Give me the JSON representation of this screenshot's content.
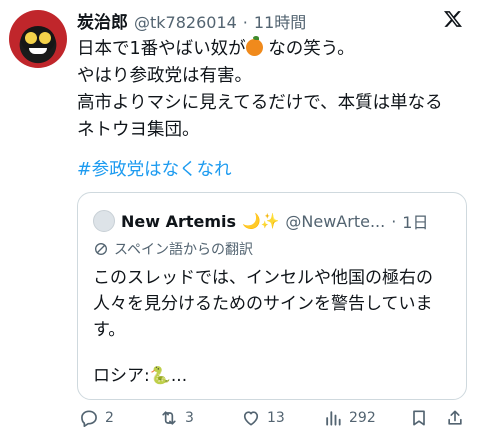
{
  "post": {
    "author_name": "炭治郎",
    "author_handle": "@tk7826014",
    "separator": "·",
    "time": "11時間",
    "lines": [
      "日本で1番やばい奴が",
      "なの笑う。",
      "やはり参政党は有害。",
      "高市よりマシに見えてるだけで、本質は単なる",
      "ネトウヨ集団。"
    ],
    "hashtag": "#参政党はなくなれ"
  },
  "quote": {
    "name": "New Artemis",
    "name_emoji": "🌙✨",
    "handle": "@NewArte...",
    "separator": "·",
    "time": "1日",
    "translation_label": "スペイン語からの翻訳",
    "lines": [
      "このスレッドでは、インセルや他国の極右の",
      "人々を見分けるためのサインを警告していま",
      "す。"
    ],
    "last_line": "ロシア:",
    "snake": "🐍",
    "ellipsis": "..."
  },
  "actions": {
    "reply_count": "2",
    "retweet_count": "3",
    "like_count": "13",
    "view_count": "292"
  },
  "colors": {
    "text": "#0f1419",
    "secondary": "#536471",
    "link": "#1d9bf0",
    "border": "#cfd9de"
  },
  "icons": [
    "x-logo-icon",
    "reply-icon",
    "retweet-icon",
    "like-icon",
    "views-icon",
    "bookmark-icon",
    "share-icon",
    "translate-icon"
  ]
}
